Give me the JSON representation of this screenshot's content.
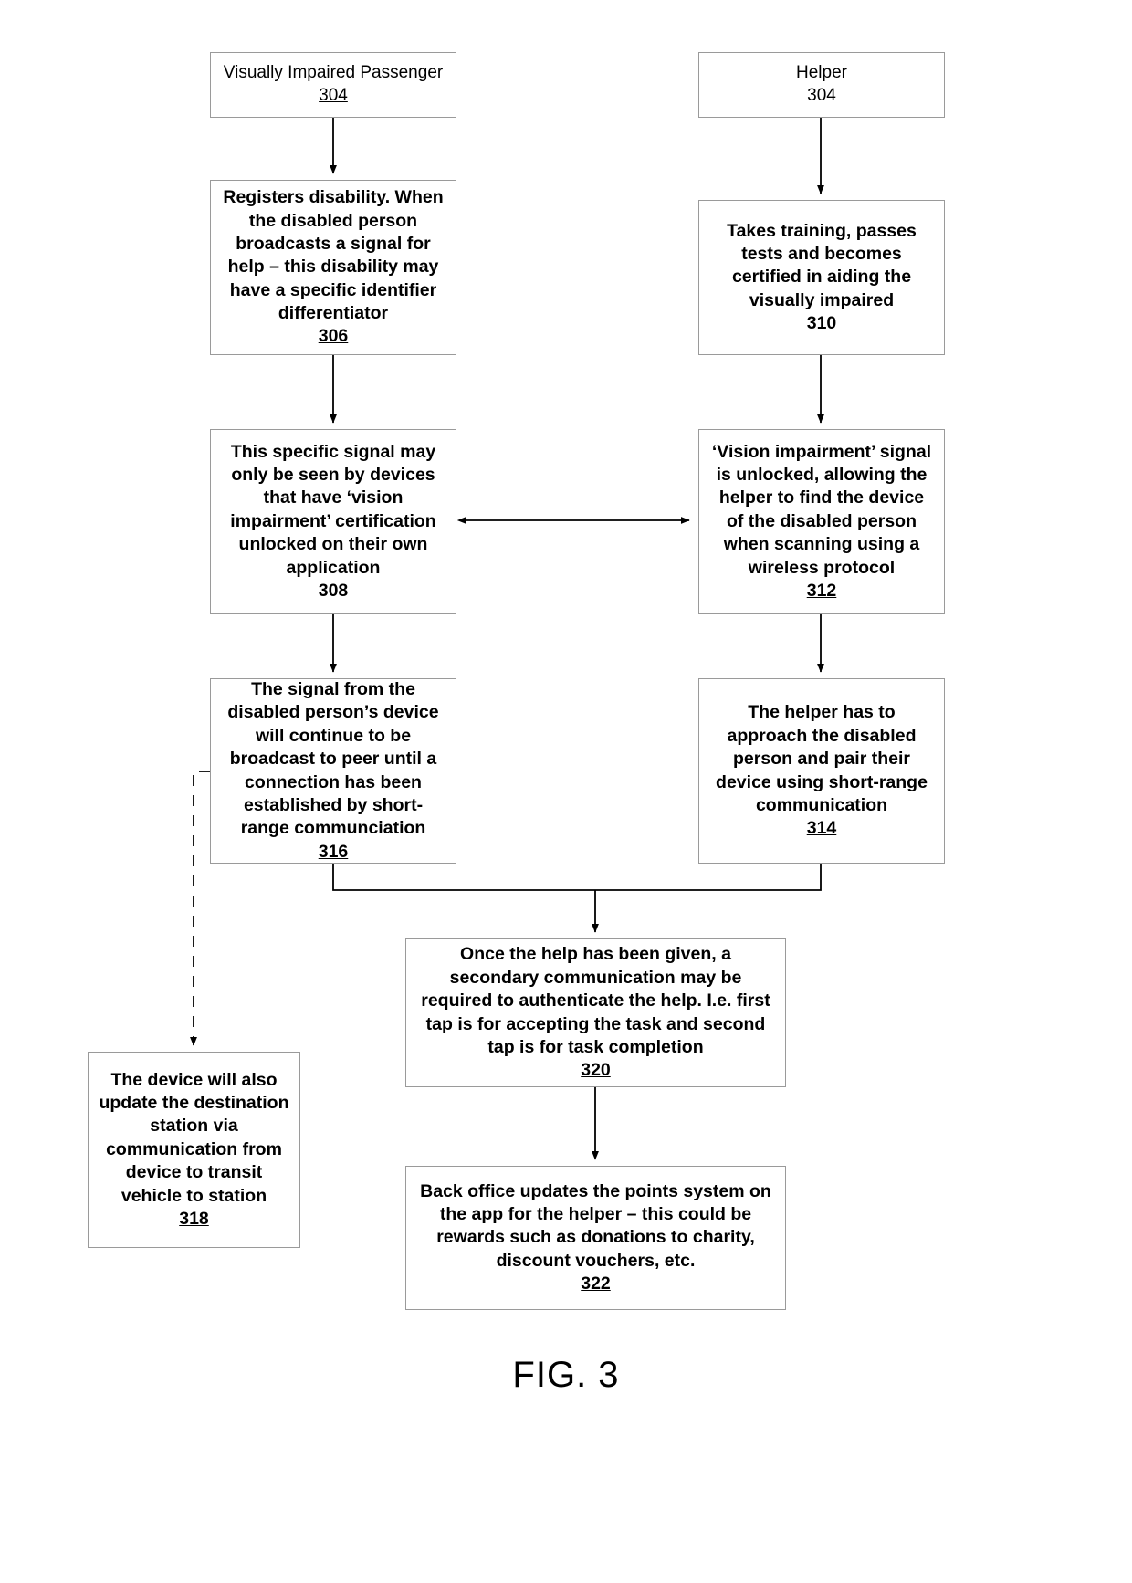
{
  "figure": {
    "caption": "FIG. 3"
  },
  "lanes": [
    {
      "id": "lane-passenger",
      "title": "Visually Impaired Passenger",
      "ref": "304",
      "ref_underlined": true
    },
    {
      "id": "lane-helper",
      "title": "Helper",
      "ref": "304",
      "ref_underlined": false
    }
  ],
  "nodes": [
    {
      "id": "node-306",
      "lane": "passenger",
      "text": "Registers disability.  When the disabled person broadcasts a signal for help – this disability may have a specific identifier differentiator",
      "ref": "306",
      "ref_underlined": true
    },
    {
      "id": "node-310",
      "lane": "helper",
      "text": "Takes training, passes tests and becomes certified in aiding the visually impaired",
      "ref": "310",
      "ref_underlined": true
    },
    {
      "id": "node-308",
      "lane": "passenger",
      "text": "This specific signal may only be seen by devices that have ‘vision impairment’ certification unlocked on their own application",
      "ref": "308",
      "ref_underlined": false
    },
    {
      "id": "node-312",
      "lane": "helper",
      "text": "‘Vision impairment’ signal is unlocked, allowing the helper to find the device of the disabled person when scanning using a wireless protocol",
      "ref": "312",
      "ref_underlined": true
    },
    {
      "id": "node-316",
      "lane": "passenger",
      "text": "The signal from the disabled person’s device will continue to be broadcast to peer until a connection has been established by short-range communciation",
      "ref": "316",
      "ref_underlined": true
    },
    {
      "id": "node-314",
      "lane": "helper",
      "text": "The helper has to approach the disabled person and pair their device using short-range communication",
      "ref": "314",
      "ref_underlined": true
    },
    {
      "id": "node-320",
      "lane": "center",
      "text": "Once the help has been given, a secondary communication may be required to authenticate the help.  I.e. first tap is for accepting the task and second tap is for task completion",
      "ref": "320",
      "ref_underlined": true
    },
    {
      "id": "node-322",
      "lane": "center",
      "text": "Back office updates the points system on the app for the helper – this could be rewards such as donations to charity, discount vouchers, etc.",
      "ref": "322",
      "ref_underlined": true
    },
    {
      "id": "node-318",
      "lane": "left-outer",
      "text": "The device will also update the destination station via communication from device to transit vehicle to station",
      "ref": "318",
      "ref_underlined": true
    }
  ],
  "connectors": [
    {
      "id": "c-304p-306",
      "from": "lane-passenger",
      "to": "node-306",
      "style": "solid",
      "arrows": "end"
    },
    {
      "id": "c-304h-310",
      "from": "lane-helper",
      "to": "node-310",
      "style": "solid",
      "arrows": "end"
    },
    {
      "id": "c-306-308",
      "from": "node-306",
      "to": "node-308",
      "style": "solid",
      "arrows": "end"
    },
    {
      "id": "c-310-312",
      "from": "node-310",
      "to": "node-312",
      "style": "solid",
      "arrows": "end"
    },
    {
      "id": "c-308-312",
      "from": "node-308",
      "to": "node-312",
      "style": "solid",
      "arrows": "both"
    },
    {
      "id": "c-308-316",
      "from": "node-308",
      "to": "node-316",
      "style": "solid",
      "arrows": "end"
    },
    {
      "id": "c-312-314",
      "from": "node-312",
      "to": "node-314",
      "style": "solid",
      "arrows": "end"
    },
    {
      "id": "c-merge-320",
      "from": "node-316,node-314",
      "to": "node-320",
      "style": "solid",
      "arrows": "end"
    },
    {
      "id": "c-320-322",
      "from": "node-320",
      "to": "node-322",
      "style": "solid",
      "arrows": "end"
    },
    {
      "id": "c-316-318",
      "from": "node-316",
      "to": "node-318",
      "style": "dashed",
      "arrows": "end"
    }
  ],
  "colors": {
    "background": "#ffffff",
    "box_border": "#9a9a9a",
    "line": "#000000",
    "text": "#000000"
  }
}
